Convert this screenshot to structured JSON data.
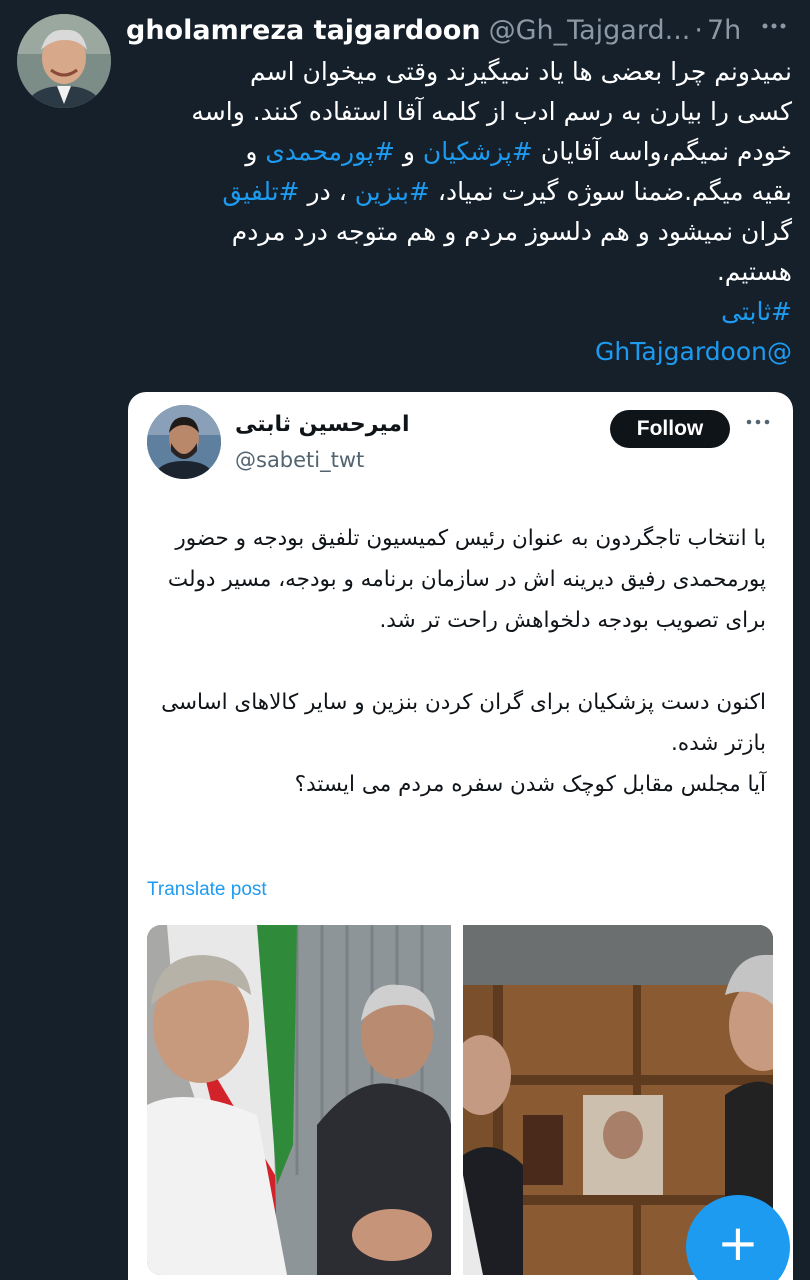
{
  "tweet": {
    "display_name": "gholamreza tajgardoon",
    "handle": "@Gh_Tajgard...",
    "separator": "·",
    "time": "7h",
    "text_lines": [
      "نمیدونم چرا بعضی ها یاد نمیگیرند وقتی میخوان اسم",
      "کسی را بیارن به رسم ادب از کلمه آقا استفاده کنند. واسه"
    ],
    "line3_prefix": "خودم نمیگم،واسه آقایان ",
    "hashtag_pezeshkian": "#پزشکیان",
    "line3_mid": " و ",
    "hashtag_pourmohammadi": "#پورمحمدی",
    "line3_suffix": " و",
    "line4_prefix": "بقیه میگم.ضمنا سوژه گیرت نمیاد، ",
    "hashtag_benzin": "#بنزین",
    "line4_mid": " ، در ",
    "hashtag_talfigh": "#تلفیق",
    "line5": "گران نمیشود و هم دلسوز مردم و هم متوجه درد مردم",
    "line6": "هستیم.",
    "hashtag_sabeti": "#ثابتی",
    "mention": "@GhTajgardoon",
    "more_icon": "more-icon"
  },
  "quote": {
    "name": "امیرحسین ثابتی",
    "handle": "@sabeti_twt",
    "follow_label": "Follow",
    "paragraph1": "با انتخاب تاجگردون به عنوان رئیس کمیسیون تلفیق بودجه و حضور پورمحمدی رفیق دیرینه اش در سازمان برنامه و بودجه، مسیر دولت برای تصویب بودجه دلخواهش راحت تر شد.",
    "paragraph2_line1": "اکنون دست پزشکیان برای گران کردن بنزین و سایر کالاهای اساسی بازتر شده.",
    "paragraph2_line2": "آیا مجلس مقابل کوچک شدن سفره مردم می ایستد؟",
    "translate_label": "Translate post"
  },
  "fab": {
    "label": "+",
    "icon": "plus-icon"
  },
  "colors": {
    "background": "#15202b",
    "link": "#1d9bf0",
    "card": "#ffffff",
    "follow_button": "#0f1419"
  }
}
